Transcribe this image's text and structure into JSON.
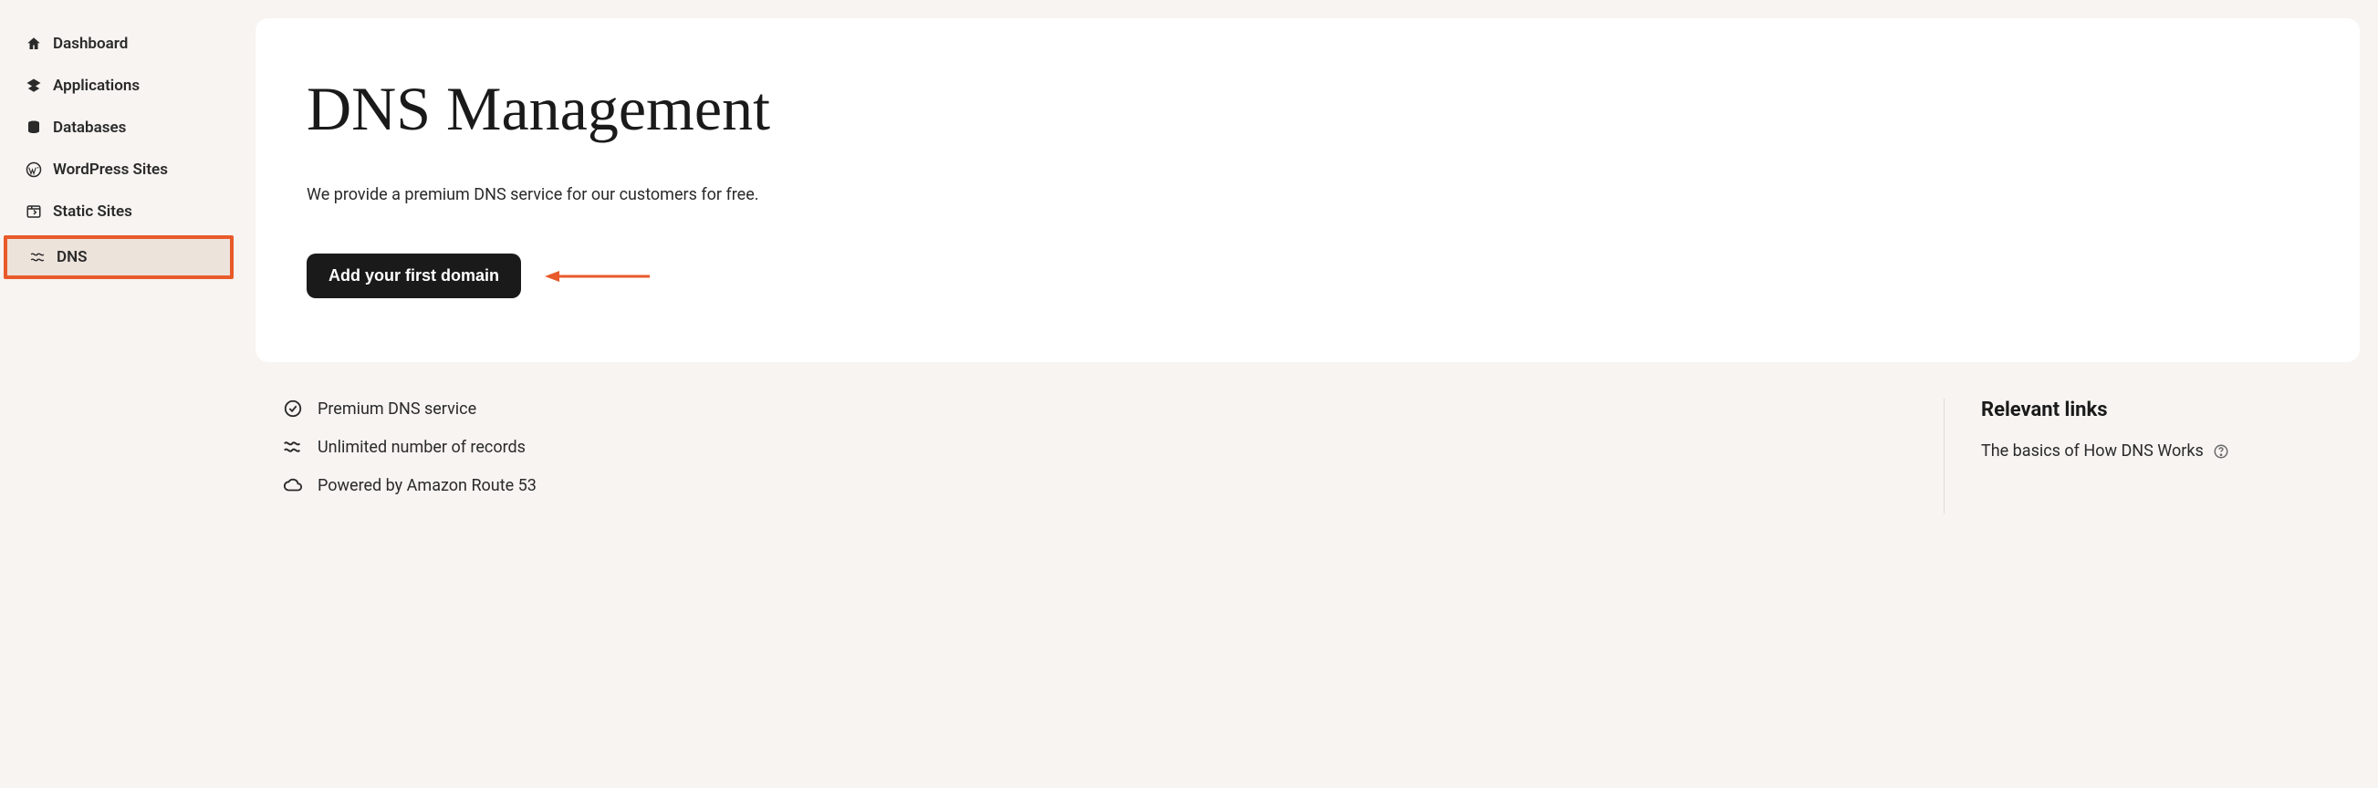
{
  "sidebar": {
    "items": [
      {
        "label": "Dashboard",
        "icon": "home-icon"
      },
      {
        "label": "Applications",
        "icon": "apps-icon"
      },
      {
        "label": "Databases",
        "icon": "database-icon"
      },
      {
        "label": "WordPress Sites",
        "icon": "wordpress-icon"
      },
      {
        "label": "Static Sites",
        "icon": "static-icon"
      },
      {
        "label": "DNS",
        "icon": "dns-icon",
        "active": true
      }
    ]
  },
  "main": {
    "title": "DNS Management",
    "description": "We provide a premium DNS service for our customers for free.",
    "cta_label": "Add your first domain"
  },
  "features": [
    "Premium DNS service",
    "Unlimited number of records",
    "Powered by Amazon Route 53"
  ],
  "relevant_links": {
    "title": "Relevant links",
    "items": [
      {
        "label": "The basics of How DNS Works"
      }
    ]
  }
}
